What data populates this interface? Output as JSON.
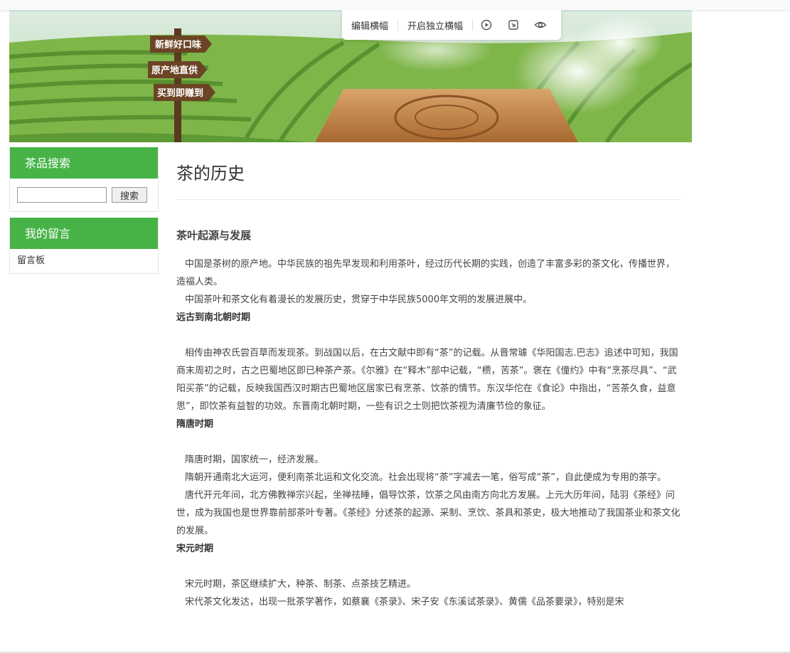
{
  "toolbar": {
    "edit_label": "编辑横幅",
    "standalone_label": "开启独立横幅",
    "icons": [
      "play-icon",
      "resize-icon",
      "eye-icon"
    ]
  },
  "banner": {
    "signs": [
      "新鲜好口味",
      "原产地直供",
      "买到即赚到"
    ]
  },
  "sidebar": {
    "search_title": "茶品搜索",
    "search_button": "搜索",
    "search_value": "",
    "messages_title": "我的留言",
    "messages_link": "留言板"
  },
  "article": {
    "title": "茶的历史",
    "subtitle": "茶叶起源与发展",
    "intro": [
      "中国是茶树的原产地。中华民族的祖先早发现和利用茶叶，经过历代长期的实践，创造了丰富多彩的茶文化，传播世界，造福人类。",
      "中国茶叶和茶文化有着漫长的发展历史，贯穿于中华民族5000年文明的发展进展中。"
    ],
    "sections": [
      {
        "heading": "远古到南北朝时期",
        "paras": [
          "相传由神农氏尝百草而发现茶。到战国以后，在古文献中即有“茶”的记载。从晋常璩《华阳国志.巴志》追述中可知，我国商末周初之时，古之巴蜀地区即已种茶产茶。《尔雅》在“释木”部中记载，“槚，苦茶”。褒在《僮约》中有“烹茶尽具”、“武阳买茶”的记载，反映我国西汉时期古巴蜀地区居家已有烹茶、饮茶的情节。东汉华佗在《食论》中指出，“苦茶久食，益意思”，即饮茶有益智的功效。东晋南北朝时期，一些有识之士则把饮茶视为清廉节俭的象征。"
        ]
      },
      {
        "heading": "隋唐时期",
        "paras": [
          "隋唐时期，国家统一，经济发展。",
          "隋朝开通南北大运河，便利南茶北运和文化交流。社会出现将“荼”字减去一笔，俗写成“茶”，自此便成为专用的茶字。",
          "唐代开元年间，北方佛教禅宗兴起，坐禅祛睡，倡导饮茶，饮茶之风由南方向北方发展。上元大历年间，陆羽《茶经》问世，成为我国也是世界靠前部茶叶专著。《茶经》分述茶的起源、采制、烹饮、茶具和茶史，极大地推动了我国茶业和茶文化的发展。"
        ]
      },
      {
        "heading": "宋元时期",
        "paras": [
          "宋元时期，茶区继续扩大，种茶、制茶、点茶技艺精进。",
          "宋代茶文化发达，出现一批茶学著作，如蔡襄《茶录》、宋子安《东溪试茶录》、黄儒《品茶要录》，特别是宋"
        ]
      }
    ]
  }
}
